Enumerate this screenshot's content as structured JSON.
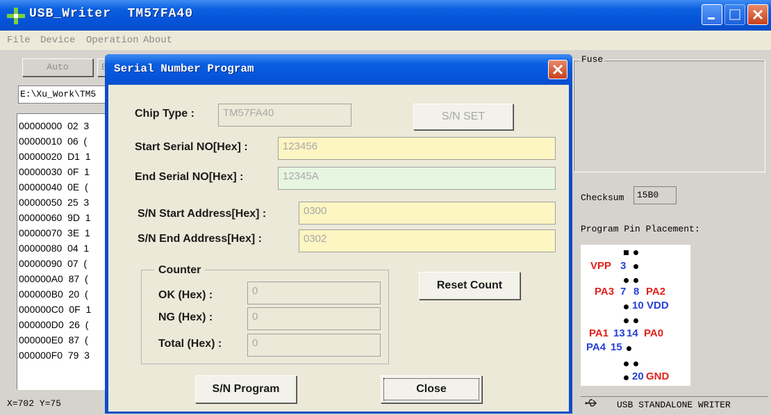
{
  "window": {
    "title": "USB_Writer  TM57FA40",
    "minimize_icon": "minimize-icon",
    "maximize_icon": "maximize-icon",
    "close_icon": "close-icon"
  },
  "menu": [
    "File",
    "Device",
    "Operation",
    "About"
  ],
  "toolbar": {
    "auto_label": "Auto",
    "second_label_partial": "E"
  },
  "path_value": "E:\\Xu_Work\\TM5",
  "hex_rows": [
    "00000000  02  3",
    "00000010  06  (",
    "00000020  D1  1",
    "00000030  0F  1",
    "00000040  0E  (",
    "00000050  25  3",
    "00000060  9D  1",
    "00000070  3E  1",
    "00000080  04  1",
    "00000090  07  (",
    "000000A0  87  (",
    "000000B0  20  (",
    "000000C0  0F  1",
    "000000D0  26  (",
    "000000E0  87  (",
    "000000F0  79  3"
  ],
  "status_coords": "X=702 Y=75",
  "fuse": {
    "label": "Fuse"
  },
  "checksum": {
    "label": "Checksum",
    "value": "15B0"
  },
  "pin_placement": {
    "label": "Program Pin Placement:",
    "pins": {
      "vpp": "VPP",
      "n3": "3",
      "pa3": "PA3",
      "n7": "7",
      "n8": "8",
      "pa2": "PA2",
      "n10": "10",
      "vdd": "VDD",
      "pa1": "PA1",
      "n13": "13",
      "n14": "14",
      "pa0": "PA0",
      "pa4": "PA4",
      "n15": "15",
      "n20": "20",
      "gnd": "GND"
    }
  },
  "status_right": {
    "icon": "usb-icon",
    "text": "USB STANDALONE WRITER"
  },
  "dialog": {
    "title": "Serial Number Program",
    "chip_type_label": "Chip Type :",
    "chip_type_value": "TM57FA40",
    "sn_set_button": "S/N SET",
    "start_serial_label": "Start Serial NO[Hex] :",
    "start_serial_value": "123456",
    "end_serial_label": "End Serial NO[Hex] :",
    "end_serial_value": "12345A",
    "sn_start_addr_label": "S/N Start Address[Hex] :",
    "sn_start_addr_value": "0300",
    "sn_end_addr_label": "S/N End Address[Hex] :",
    "sn_end_addr_value": "0302",
    "counter": {
      "label": "Counter",
      "ok_label": "OK (Hex) :",
      "ok_value": "0",
      "ng_label": "NG (Hex) :",
      "ng_value": "0",
      "total_label": "Total (Hex) :",
      "total_value": "0"
    },
    "reset_count_button": "Reset Count",
    "sn_program_button": "S/N Program",
    "close_button": "Close"
  },
  "colors": {
    "titlebar_blue": "#0553d8",
    "pin_red": "#e0201c",
    "pin_blue": "#2540d8",
    "field_yellow": "#fdf5c2",
    "field_green": "#e6f6e0"
  }
}
